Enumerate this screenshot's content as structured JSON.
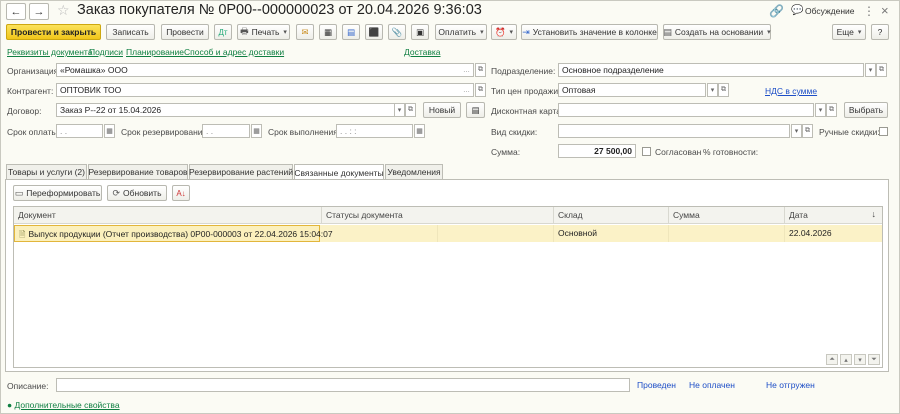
{
  "header": {
    "back": "←",
    "forward": "→",
    "title": "Заказ покупателя № 0Р00--000000023 от 20.04.2026 9:36:03",
    "discuss": "Обсуждение",
    "more": "⋮",
    "close": "×"
  },
  "toolbar": {
    "post_close": "Провести и закрыть",
    "save": "Записать",
    "post": "Провести",
    "print": "Печать",
    "pay": "Оплатить",
    "set_value": "Установить значение в колонке",
    "create_based": "Создать на основании",
    "more": "Еще",
    "help": "?"
  },
  "links": {
    "requisites": "Реквизиты документа",
    "signatures": "Подписи",
    "planning": "Планирование",
    "delivery_method": "Способ и адрес доставки",
    "delivery": "Доставка",
    "vat": "НДС в сумме",
    "extra_props": "Дополнительные свойства"
  },
  "form": {
    "org_label": "Организация:",
    "org_value": "«Ромашка» ООО",
    "contractor_label": "Контрагент:",
    "contractor_value": "ОПТОВИК ТОО",
    "contract_label": "Договор:",
    "contract_value": "Заказ Р--22 от 15.04.2026",
    "new_btn": "Новый",
    "pay_term_label": "Срок оплаты:",
    "pay_term_value": ". .",
    "reserve_term_label": "Срок резервирования:",
    "reserve_term_value": ". .",
    "exec_term_label": "Срок выполнения:",
    "exec_term_value": ". .   : :",
    "division_label": "Подразделение:",
    "division_value": "Основное подразделение",
    "price_type_label": "Тип цен продажи:",
    "price_type_value": "Оптовая",
    "discount_card_label": "Дисконтная карта:",
    "choose_btn": "Выбрать",
    "discount_type_label": "Вид скидки:",
    "manual_discount_label": "Ручные скидки:",
    "sum_label": "Сумма:",
    "sum_value": "27 500,00",
    "agreed_label": "Согласован",
    "ready_label": "% готовности:",
    "description_label": "Описание:"
  },
  "tabs": [
    "Товары и услуги (2)",
    "Резервирование товаров",
    "Резервирование растений",
    "Связанные документы",
    "Уведомления"
  ],
  "related": {
    "reform_btn": "Переформировать",
    "refresh_btn": "Обновить",
    "columns": [
      "Документ",
      "Статусы документа",
      "Склад",
      "Сумма",
      "Дата"
    ],
    "rows": [
      {
        "document": "Выпуск продукции (Отчет производства) 0Р00-000003 от 22.04.2026 15:04:07",
        "statuses": "",
        "warehouse": "Основной",
        "sum": "",
        "date": "22.04.2026"
      }
    ]
  },
  "status": {
    "posted": "Проведен",
    "not_paid": "Не оплачен",
    "not_shipped": "Не отгружен"
  }
}
